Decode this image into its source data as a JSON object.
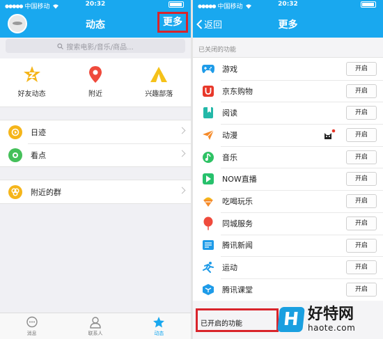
{
  "left": {
    "status": {
      "carrier": "中国移动",
      "time": "20:32"
    },
    "nav": {
      "title": "动态",
      "more": "更多"
    },
    "search": {
      "placeholder": "搜索电影/音乐/商品..."
    },
    "quick": [
      {
        "label": "好友动态",
        "icon": "friend-feed-icon"
      },
      {
        "label": "附近",
        "icon": "location-pin-icon"
      },
      {
        "label": "兴趣部落",
        "icon": "tribe-tent-icon"
      }
    ],
    "group1": [
      {
        "label": "日迹",
        "icon": "daily-trace-icon"
      },
      {
        "label": "看点",
        "icon": "highlights-eye-icon"
      }
    ],
    "group2": [
      {
        "label": "附近的群",
        "icon": "nearby-group-icon"
      }
    ],
    "tabs": [
      {
        "label": "消息",
        "icon": "message-icon"
      },
      {
        "label": "联系人",
        "icon": "contacts-icon"
      },
      {
        "label": "动态",
        "icon": "star-icon"
      }
    ]
  },
  "right": {
    "status": {
      "carrier": "中国移动",
      "time": "20:32"
    },
    "nav": {
      "back": "返回",
      "title": "更多"
    },
    "closed_label": "已关闭的功能",
    "open_label": "已开启的功能",
    "button_label": "开启",
    "items": [
      {
        "label": "游戏",
        "icon": "gamepad-icon"
      },
      {
        "label": "京东购物",
        "icon": "jd-shopping-icon"
      },
      {
        "label": "阅读",
        "icon": "bookmark-icon"
      },
      {
        "label": "动漫",
        "icon": "paper-plane-icon"
      },
      {
        "label": "音乐",
        "icon": "music-note-icon"
      },
      {
        "label": "NOW直播",
        "icon": "now-live-icon"
      },
      {
        "label": "吃喝玩乐",
        "icon": "food-icon"
      },
      {
        "label": "同城服务",
        "icon": "balloon-icon"
      },
      {
        "label": "腾讯新闻",
        "icon": "news-icon"
      },
      {
        "label": "运动",
        "icon": "running-icon"
      },
      {
        "label": "腾讯课堂",
        "icon": "classroom-icon"
      }
    ]
  },
  "watermark": {
    "logo": "H",
    "name": "好特网",
    "domain": "haote.com"
  },
  "colors": {
    "brand": "#19a8ef",
    "highlight": "#d9242b"
  }
}
